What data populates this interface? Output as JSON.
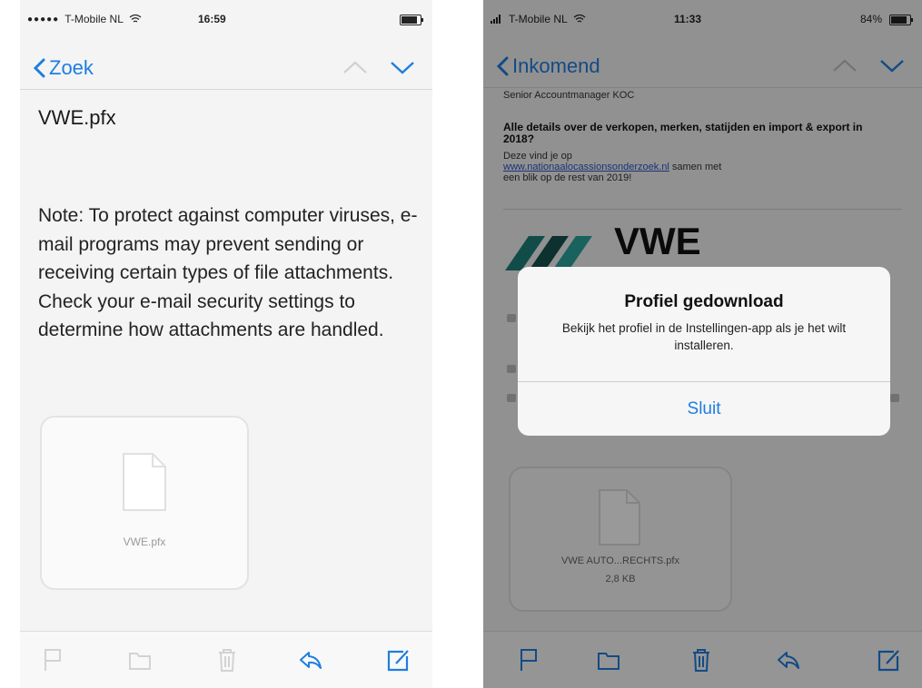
{
  "left": {
    "status": {
      "carrier": "T-Mobile NL",
      "time": "16:59"
    },
    "nav": {
      "back_label": "Zoek"
    },
    "email": {
      "filename": "VWE.pfx",
      "note": "Note: To protect against computer viruses, e-mail programs may prevent sending or receiving certain types of file attachments.  Check your e-mail security settings to determine how attachments are handled.",
      "attachment_name": "VWE.pfx"
    },
    "toolbar": [
      "flag-icon",
      "folder-icon",
      "trash-icon",
      "reply-icon",
      "compose-icon"
    ]
  },
  "right": {
    "status": {
      "carrier": "T-Mobile NL",
      "time": "11:33",
      "battery": "84%"
    },
    "nav": {
      "back_label": "Inkomend"
    },
    "email": {
      "sender": "Senior Accountmanager KOC",
      "headline": "Alle details over de verkopen, merken, statijden en import & export in 2018?",
      "body_intro": "Deze vind je op",
      "link": "www.nationaalocassionsonderzoek.nl",
      "body_after_link": " samen met",
      "body_end": "een blik op de rest van 2019!",
      "logo_text": "VWE",
      "attachment_name": "VWE AUTO...RECHTS.pfx",
      "attachment_size": "2,8 KB"
    },
    "alert": {
      "title": "Profiel gedownload",
      "message": "Bekijk het profiel in de Instellingen-app als je het wilt installeren.",
      "button": "Sluit"
    },
    "toolbar": [
      "flag-icon",
      "folder-icon",
      "trash-icon",
      "reply-icon",
      "compose-icon"
    ]
  },
  "colors": {
    "accent": "#1e7ee0",
    "link": "#2b56c8",
    "logo_teal": "#1f7f7a"
  }
}
